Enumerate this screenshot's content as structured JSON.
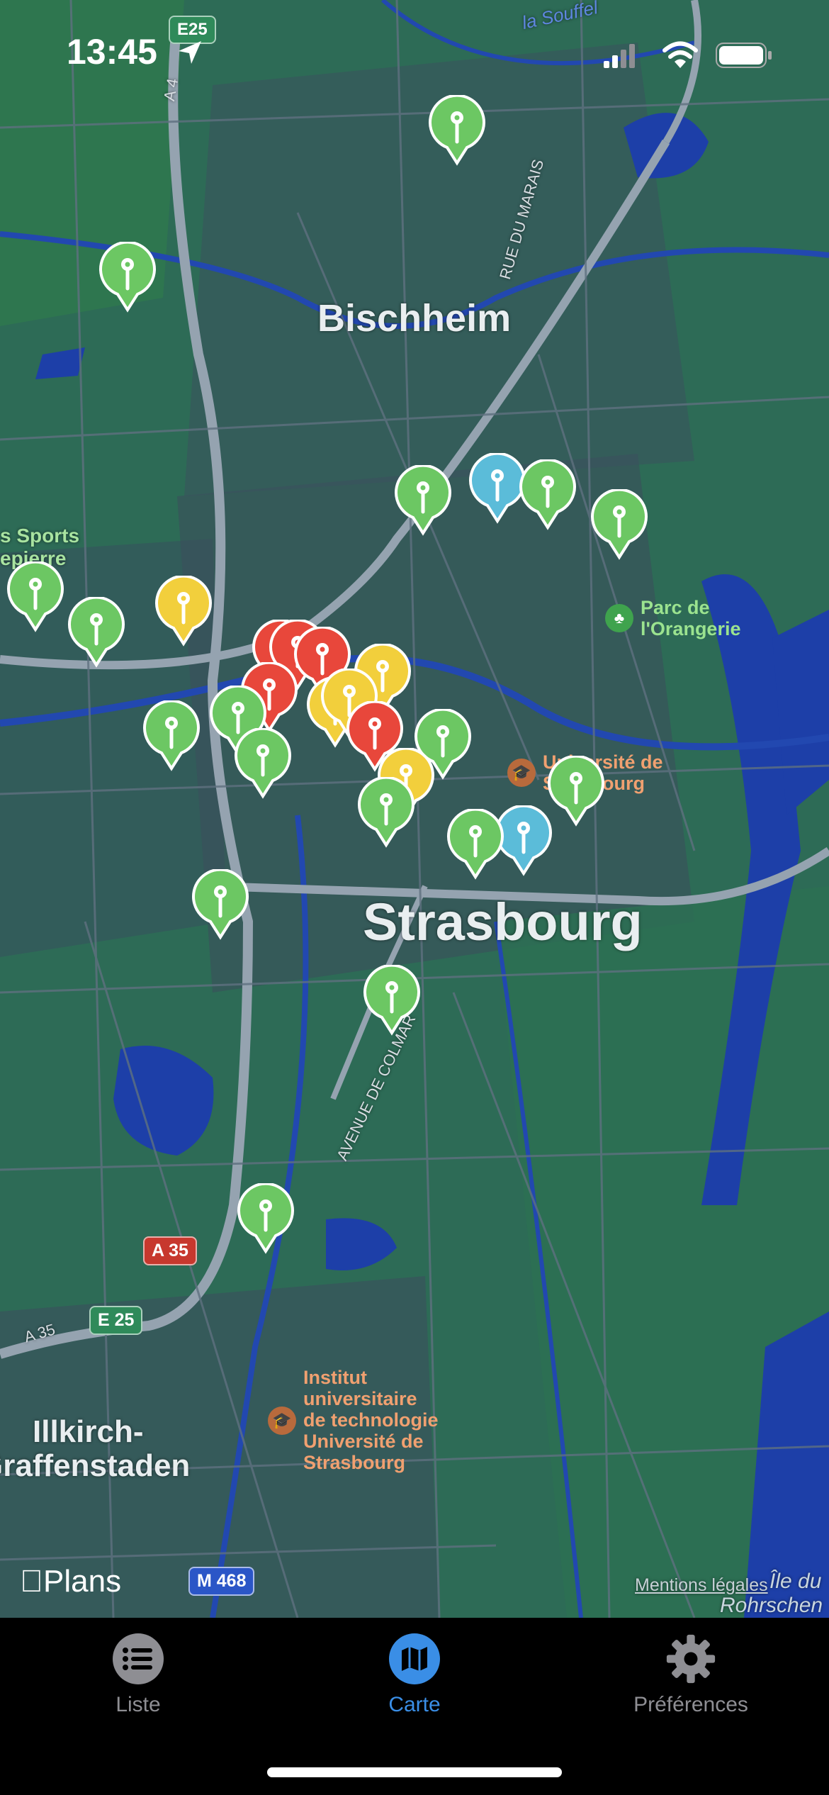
{
  "status_bar": {
    "time": "13:45",
    "colors": {
      "text": "#ffffff"
    }
  },
  "map": {
    "place_labels": {
      "bischheim": "Bischheim",
      "strasbourg": "Strasbourg",
      "illkirch_1": "Illkirch-",
      "illkirch_2": "Graffenstaden",
      "sports_1": "s Sports",
      "sports_2": "epierre",
      "river_souffel": "la Souffel",
      "rue_du_marais": "RUE DU MARAIS",
      "avenue_de_colmar": "AVENUE DE COLMAR",
      "ile_1": "Île du",
      "ile_2": "Rohrschen",
      "a35_road": "A 35",
      "a4_road": "A 4"
    },
    "pois": {
      "parc": "Parc de\nl'Orangerie",
      "universite": "Université de\nStrasbourg",
      "institut": "Institut\nuniversitaire\nde technologie\nUniversité de\nStrasbourg"
    },
    "shields": {
      "e25_top": "E25",
      "a35": "A 35",
      "e25_bottom": "E 25",
      "m468": "M 468"
    },
    "attribution": {
      "brand": "Plans",
      "legal": "Mentions légales"
    },
    "pin_colors": {
      "green": "#6cc763",
      "yellow": "#f2cf3c",
      "red": "#e8473b",
      "blue": "#5bbcd9"
    },
    "pins": [
      {
        "color": "green"
      },
      {
        "color": "green"
      },
      {
        "color": "green"
      },
      {
        "color": "blue"
      },
      {
        "color": "green"
      },
      {
        "color": "green"
      },
      {
        "color": "green"
      },
      {
        "color": "green"
      },
      {
        "color": "yellow"
      },
      {
        "color": "red"
      },
      {
        "color": "red"
      },
      {
        "color": "red"
      },
      {
        "color": "red"
      },
      {
        "color": "yellow"
      },
      {
        "color": "yellow"
      },
      {
        "color": "yellow"
      },
      {
        "color": "red"
      },
      {
        "color": "green"
      },
      {
        "color": "green"
      },
      {
        "color": "green"
      },
      {
        "color": "green"
      },
      {
        "color": "yellow"
      },
      {
        "color": "green"
      },
      {
        "color": "green"
      },
      {
        "color": "blue"
      },
      {
        "color": "green"
      },
      {
        "color": "green"
      },
      {
        "color": "green"
      },
      {
        "color": "green"
      }
    ]
  },
  "tabbar": {
    "tabs": [
      {
        "label": "Liste",
        "icon": "list-icon",
        "selected": false
      },
      {
        "label": "Carte",
        "icon": "map-icon",
        "selected": true
      },
      {
        "label": "Préférences",
        "icon": "gear-icon",
        "selected": false
      }
    ],
    "colors": {
      "selected": "#3a8ee6",
      "unselected": "#8e8e93"
    }
  }
}
